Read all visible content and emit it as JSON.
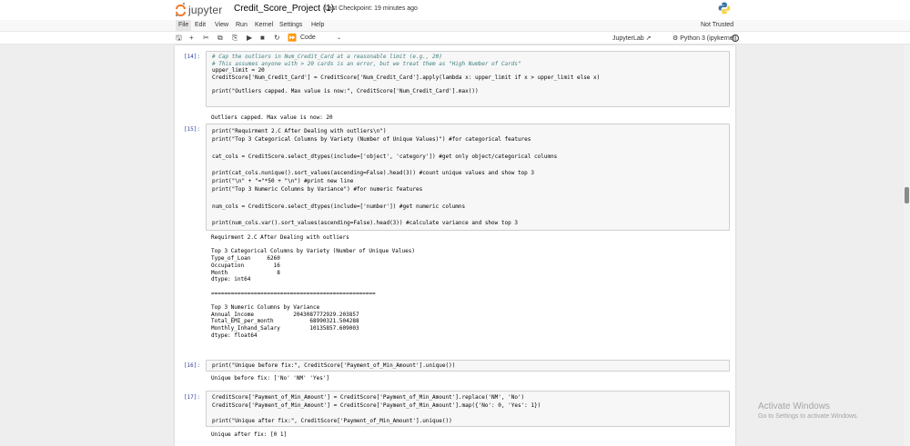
{
  "header": {
    "logo_text": "jupyter",
    "notebook_title": "Credit_Score_Project (1)",
    "checkpoint": "Last Checkpoint: 19 minutes ago"
  },
  "menu": {
    "items": [
      "File",
      "Edit",
      "View",
      "Run",
      "Kernel",
      "Settings",
      "Help"
    ],
    "trust_status": "Not Trusted"
  },
  "toolbar": {
    "icons": [
      "save-icon",
      "add-cell-icon",
      "cut-icon",
      "copy-icon",
      "paste-icon",
      "run-icon",
      "stop-icon",
      "restart-icon",
      "fast-forward-icon"
    ],
    "cell_type": "Code",
    "jupyterlab_label": "JupyterLab",
    "kernel_name": "Python 3 (ipykernel)"
  },
  "cells": [
    {
      "prompt": "[14]:",
      "input_lines": [
        "# Cap the outliers in Num_Credit_Card at a reasonable limit (e.g., 20)",
        "# This assumes anyone with > 20 cards is an error, but we treat them as \"High Number of Cards\"",
        "upper_limit = 20",
        "CreditScore['Num_Credit_Card'] = CreditScore['Num_Credit_Card'].apply(lambda x: upper_limit if x > upper_limit else x)",
        "",
        "print(\"Outliers capped. Max value is now:\", CreditScore['Num_Credit_Card'].max())"
      ],
      "output_lines": [
        "Outliers capped. Max value is now: 20"
      ]
    },
    {
      "prompt": "[15]:",
      "input_lines": [
        "print(\"Requirment 2.C After Dealing with outliers\\n\")",
        "print(\"Top 3 Categorical Columns by Variety (Number of Unique Values)\") #for categorical features",
        "",
        "cat_cols = CreditScore.select_dtypes(include=['object', 'category']) #get only object/categorical columns",
        "",
        "print(cat_cols.nunique().sort_values(ascending=False).head(3)) #count unique values and show top 3",
        "print(\"\\n\" + \"=\"*50 + \"\\n\") #print new line",
        "print(\"Top 3 Numeric Columns by Variance\") #for numeric features",
        "",
        "num_cols = CreditScore.select_dtypes(include=['number']) #get numeric columns",
        "",
        "print(num_cols.var().sort_values(ascending=False).head(3)) #calculate variance and show top 3"
      ],
      "output_lines": [
        "Requirment 2.C After Dealing with outliers",
        "",
        "Top 3 Categorical Columns by Variety (Number of Unique Values)",
        "Type_of_Loan     6260",
        "Occupation         16",
        "Month               8",
        "dtype: int64",
        "",
        "==================================================",
        "",
        "Top 3 Numeric Columns by Variance",
        "Annual_Income            2043087772929.203857",
        "Total_EMI_per_month           68990321.504288",
        "Monthly_Inhand_Salary         10135857.609003",
        "dtype: float64"
      ]
    },
    {
      "prompt": "[16]:",
      "input_lines": [
        "print(\"Unique before fix:\", CreditScore['Payment_of_Min_Amount'].unique())"
      ],
      "output_lines": [
        "Unique before fix: ['No' 'NM' 'Yes']"
      ]
    },
    {
      "prompt": "[17]:",
      "input_lines": [
        "CreditScore['Payment_of_Min_Amount'] = CreditScore['Payment_of_Min_Amount'].replace('NM', 'No')",
        "CreditScore['Payment_of_Min_Amount'] = CreditScore['Payment_of_Min_Amount'].map({'No': 0, 'Yes': 1})",
        "",
        "print(\"Unique after fix:\", CreditScore['Payment_of_Min_Amount'].unique())"
      ],
      "output_lines": [
        "Unique after fix: [0 1]"
      ]
    }
  ],
  "watermark": {
    "title": "Activate Windows",
    "subtitle": "Go to Settings to activate Windows."
  }
}
